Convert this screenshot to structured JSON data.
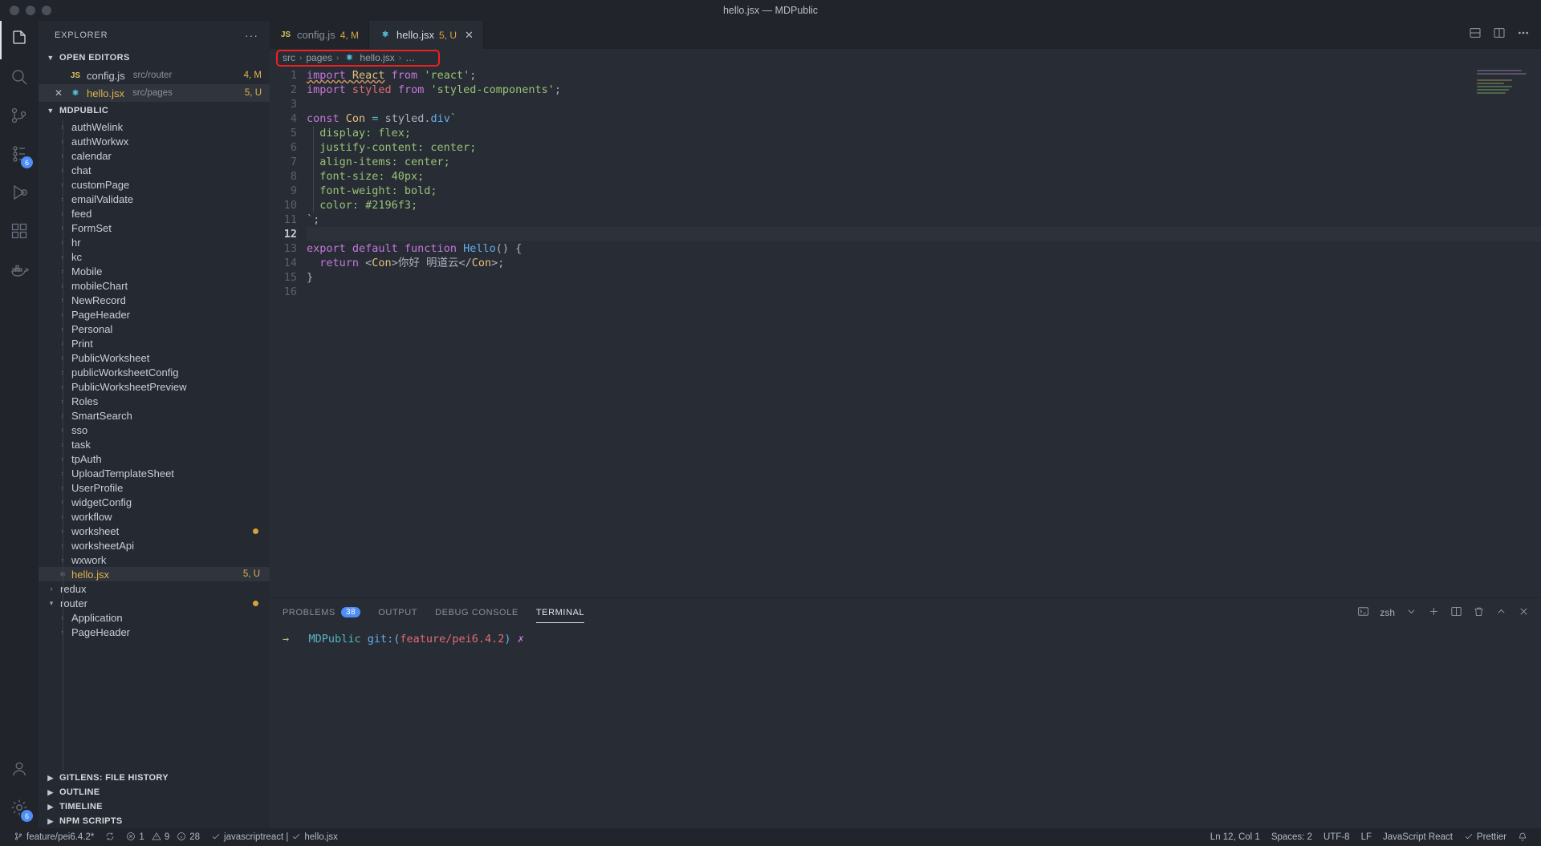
{
  "window": {
    "title": "hello.jsx — MDPublic"
  },
  "activitybar": {
    "items": [
      {
        "name": "explorer",
        "icon": "files-icon",
        "active": true,
        "badge": ""
      },
      {
        "name": "search",
        "icon": "search-icon",
        "active": false,
        "badge": ""
      },
      {
        "name": "source-control",
        "icon": "source-control-icon",
        "active": false,
        "badge": ""
      },
      {
        "name": "source-control-graph",
        "icon": "git-graph-icon",
        "active": false,
        "badge": "6"
      },
      {
        "name": "run-and-debug",
        "icon": "run-debug-icon",
        "active": false,
        "badge": ""
      },
      {
        "name": "extensions",
        "icon": "extensions-icon",
        "active": false,
        "badge": ""
      },
      {
        "name": "docker",
        "icon": "docker-icon",
        "active": false,
        "badge": ""
      }
    ],
    "bottom": [
      {
        "name": "accounts",
        "icon": "account-icon",
        "badge": ""
      },
      {
        "name": "manage",
        "icon": "gear-icon",
        "badge": "6"
      }
    ]
  },
  "sidebar": {
    "header": {
      "title": "EXPLORER",
      "more": "···"
    },
    "open_editors": {
      "label": "OPEN EDITORS",
      "items": [
        {
          "icon": "js-file-icon",
          "name": "config.js",
          "path": "src/router",
          "badge": "4, M",
          "selected": false,
          "closable": false,
          "modified": false
        },
        {
          "icon": "react-file-icon",
          "name": "hello.jsx",
          "path": "src/pages",
          "badge": "5, U",
          "selected": true,
          "closable": true,
          "modified": true
        }
      ]
    },
    "project": {
      "label": "MDPUBLIC",
      "items": [
        {
          "label": "authWelink",
          "type": "folder",
          "expanded": false,
          "depth": 1
        },
        {
          "label": "authWorkwx",
          "type": "folder",
          "expanded": false,
          "depth": 1
        },
        {
          "label": "calendar",
          "type": "folder",
          "expanded": false,
          "depth": 1
        },
        {
          "label": "chat",
          "type": "folder",
          "expanded": false,
          "depth": 1
        },
        {
          "label": "customPage",
          "type": "folder",
          "expanded": false,
          "depth": 1
        },
        {
          "label": "emailValidate",
          "type": "folder",
          "expanded": false,
          "depth": 1
        },
        {
          "label": "feed",
          "type": "folder",
          "expanded": false,
          "depth": 1
        },
        {
          "label": "FormSet",
          "type": "folder",
          "expanded": false,
          "depth": 1
        },
        {
          "label": "hr",
          "type": "folder",
          "expanded": false,
          "depth": 1
        },
        {
          "label": "kc",
          "type": "folder",
          "expanded": false,
          "depth": 1
        },
        {
          "label": "Mobile",
          "type": "folder",
          "expanded": false,
          "depth": 1
        },
        {
          "label": "mobileChart",
          "type": "folder",
          "expanded": false,
          "depth": 1
        },
        {
          "label": "NewRecord",
          "type": "folder",
          "expanded": false,
          "depth": 1
        },
        {
          "label": "PageHeader",
          "type": "folder",
          "expanded": false,
          "depth": 1
        },
        {
          "label": "Personal",
          "type": "folder",
          "expanded": false,
          "depth": 1
        },
        {
          "label": "Print",
          "type": "folder",
          "expanded": false,
          "depth": 1
        },
        {
          "label": "PublicWorksheet",
          "type": "folder",
          "expanded": false,
          "depth": 1
        },
        {
          "label": "publicWorksheetConfig",
          "type": "folder",
          "expanded": false,
          "depth": 1
        },
        {
          "label": "PublicWorksheetPreview",
          "type": "folder",
          "expanded": false,
          "depth": 1
        },
        {
          "label": "Roles",
          "type": "folder",
          "expanded": false,
          "depth": 1
        },
        {
          "label": "SmartSearch",
          "type": "folder",
          "expanded": false,
          "depth": 1
        },
        {
          "label": "sso",
          "type": "folder",
          "expanded": false,
          "depth": 1
        },
        {
          "label": "task",
          "type": "folder",
          "expanded": false,
          "depth": 1
        },
        {
          "label": "tpAuth",
          "type": "folder",
          "expanded": false,
          "depth": 1
        },
        {
          "label": "UploadTemplateSheet",
          "type": "folder",
          "expanded": false,
          "depth": 1
        },
        {
          "label": "UserProfile",
          "type": "folder",
          "expanded": false,
          "depth": 1
        },
        {
          "label": "widgetConfig",
          "type": "folder",
          "expanded": false,
          "depth": 1
        },
        {
          "label": "workflow",
          "type": "folder",
          "expanded": false,
          "depth": 1
        },
        {
          "label": "worksheet",
          "type": "folder",
          "expanded": false,
          "depth": 1,
          "dot": true
        },
        {
          "label": "worksheetApi",
          "type": "folder",
          "expanded": false,
          "depth": 1
        },
        {
          "label": "wxwork",
          "type": "folder",
          "expanded": false,
          "depth": 1
        },
        {
          "label": "hello.jsx",
          "type": "react-file",
          "expanded": false,
          "depth": 1,
          "badge": "5, U",
          "selected": true
        },
        {
          "label": "redux",
          "type": "folder",
          "expanded": false,
          "depth": 0
        },
        {
          "label": "router",
          "type": "folder",
          "expanded": true,
          "depth": 0,
          "dot": true
        },
        {
          "label": "Application",
          "type": "folder",
          "expanded": false,
          "depth": 1
        },
        {
          "label": "PageHeader",
          "type": "folder",
          "expanded": false,
          "depth": 1
        }
      ]
    },
    "bottom_sections": [
      {
        "label": "GITLENS: FILE HISTORY"
      },
      {
        "label": "OUTLINE"
      },
      {
        "label": "TIMELINE"
      },
      {
        "label": "NPM SCRIPTS"
      }
    ]
  },
  "editor": {
    "tabs": [
      {
        "icon": "js-file-icon",
        "label": "config.js",
        "badge": "4, M",
        "active": false,
        "closable": false
      },
      {
        "icon": "react-file-icon",
        "label": "hello.jsx",
        "badge": "5, U",
        "active": true,
        "closable": true
      }
    ],
    "tab_actions": [
      {
        "name": "split-editor-down-icon"
      },
      {
        "name": "split-editor-right-icon"
      },
      {
        "name": "more-actions-icon"
      }
    ],
    "breadcrumb": {
      "parts": [
        "src",
        "pages",
        "hello.jsx",
        "…"
      ],
      "separator": "›",
      "file_icon": "react-file-icon",
      "highlight_color": "#f02020"
    },
    "cursor_line": 12,
    "lines": [
      {
        "n": 1,
        "tokens": [
          {
            "t": "import ",
            "c": "purple",
            "u": true
          },
          {
            "t": "React",
            "c": "orange",
            "u": true
          },
          {
            "t": " from ",
            "c": "purple"
          },
          {
            "t": "'react'",
            "c": "green"
          },
          {
            "t": ";",
            "c": "white"
          }
        ]
      },
      {
        "n": 2,
        "tokens": [
          {
            "t": "import ",
            "c": "purple"
          },
          {
            "t": "styled",
            "c": "red"
          },
          {
            "t": " from ",
            "c": "purple"
          },
          {
            "t": "'styled-components'",
            "c": "green"
          },
          {
            "t": ";",
            "c": "white"
          }
        ]
      },
      {
        "n": 3,
        "tokens": []
      },
      {
        "n": 4,
        "tokens": [
          {
            "t": "const ",
            "c": "purple"
          },
          {
            "t": "Con",
            "c": "orange"
          },
          {
            "t": " = ",
            "c": "cyan"
          },
          {
            "t": "styled",
            "c": "white"
          },
          {
            "t": ".",
            "c": "white"
          },
          {
            "t": "div",
            "c": "blue"
          },
          {
            "t": "`",
            "c": "green"
          }
        ]
      },
      {
        "n": 5,
        "tokens": [
          {
            "t": "  display: flex;",
            "c": "green"
          }
        ]
      },
      {
        "n": 6,
        "tokens": [
          {
            "t": "  justify-content: center;",
            "c": "green"
          }
        ]
      },
      {
        "n": 7,
        "tokens": [
          {
            "t": "  align-items: center;",
            "c": "green"
          }
        ]
      },
      {
        "n": 8,
        "tokens": [
          {
            "t": "  font-size: 40px;",
            "c": "green"
          }
        ]
      },
      {
        "n": 9,
        "tokens": [
          {
            "t": "  font-weight: bold;",
            "c": "green"
          }
        ]
      },
      {
        "n": 10,
        "tokens": [
          {
            "t": "  color: #2196f3;",
            "c": "green"
          }
        ]
      },
      {
        "n": 11,
        "tokens": [
          {
            "t": "`",
            "c": "green"
          },
          {
            "t": ";",
            "c": "white"
          }
        ]
      },
      {
        "n": 12,
        "tokens": []
      },
      {
        "n": 13,
        "tokens": [
          {
            "t": "export default ",
            "c": "purple"
          },
          {
            "t": "function ",
            "c": "purple"
          },
          {
            "t": "Hello",
            "c": "blue"
          },
          {
            "t": "() {",
            "c": "white"
          }
        ]
      },
      {
        "n": 14,
        "tokens": [
          {
            "t": "  return ",
            "c": "purple"
          },
          {
            "t": "<",
            "c": "white"
          },
          {
            "t": "Con",
            "c": "orange"
          },
          {
            "t": ">",
            "c": "white"
          },
          {
            "t": "你好 明道云",
            "c": "white"
          },
          {
            "t": "</",
            "c": "white"
          },
          {
            "t": "Con",
            "c": "orange"
          },
          {
            "t": ">",
            "c": "white"
          },
          {
            "t": ";",
            "c": "white"
          }
        ]
      },
      {
        "n": 15,
        "tokens": [
          {
            "t": "}",
            "c": "white"
          }
        ]
      },
      {
        "n": 16,
        "tokens": []
      }
    ]
  },
  "panel": {
    "tabs": [
      {
        "label": "PROBLEMS",
        "badge": "38",
        "active": false
      },
      {
        "label": "OUTPUT",
        "badge": "",
        "active": false
      },
      {
        "label": "DEBUG CONSOLE",
        "badge": "",
        "active": false
      },
      {
        "label": "TERMINAL",
        "badge": "",
        "active": true
      }
    ],
    "actions": {
      "shell": "zsh",
      "icons": [
        "terminal-icon",
        "chevron-down-icon",
        "add-terminal-icon",
        "split-terminal-icon",
        "kill-terminal-icon",
        "maximize-panel-icon",
        "close-panel-icon"
      ]
    },
    "terminal_line": {
      "prompt": "→",
      "cwd": "MDPublic",
      "git_prefix": "git:(",
      "branch": "feature/pei6.4.2",
      "git_suffix": ")",
      "status": "✗"
    }
  },
  "statusbar": {
    "left": [
      {
        "name": "remote-branch",
        "icon": "source-control-icon",
        "text": "feature/pei6.4.2*"
      },
      {
        "name": "sync-changes",
        "icon": "sync-icon",
        "text": ""
      },
      {
        "name": "problems",
        "icon": "error-icon",
        "text": "1",
        "icon2": "warning-icon",
        "text2": "9",
        "icon3": "info-icon",
        "text3": "28"
      },
      {
        "name": "eslint",
        "icon": "check-icon",
        "text": "javascriptreact | ",
        "icon2": "check-icon",
        "text2": "hello.jsx"
      }
    ],
    "right": [
      {
        "name": "editor-position",
        "text": "Ln 12, Col 1"
      },
      {
        "name": "indentation",
        "text": "Spaces: 2"
      },
      {
        "name": "encoding",
        "text": "UTF-8"
      },
      {
        "name": "eol",
        "text": "LF"
      },
      {
        "name": "language-mode",
        "text": "JavaScript React"
      },
      {
        "name": "prettier",
        "text": "Prettier",
        "icon": "check-icon"
      },
      {
        "name": "notifications",
        "text": "",
        "icon": "bell-icon"
      }
    ]
  }
}
